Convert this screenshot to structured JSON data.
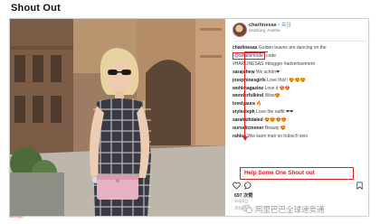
{
  "slide": {
    "title": "Shout Out"
  },
  "post": {
    "username": "charlinesas",
    "follow_label": "• 关注",
    "location": "Salzburg, Austria",
    "comments": [
      {
        "user": "charlinesas",
        "text": "Golden leaves are dancing on the"
      },
      {
        "user": "",
        "text": "code",
        "mention": "@whatismode"
      },
      {
        "user": "",
        "text": "#HARLINESAS #blogger #advertisement"
      },
      {
        "user": "sarajohew",
        "text": "We schön❤"
      },
      {
        "user": "josephinesgirls",
        "text": "Love this!! 😍😍😍"
      },
      {
        "user": "wohlmagazine",
        "text": "Love it 😍😍"
      },
      {
        "user": "wonderfulkind",
        "text": "Wow😍"
      },
      {
        "user": "lovelyaura",
        "text": "🔥"
      },
      {
        "user": "stylesteph",
        "text": "Love the outfit ❤❤"
      },
      {
        "user": "sarahkihdaled",
        "text": "😍😍😍😍"
      },
      {
        "user": "ourselicmoner",
        "text": "Beauty 😍"
      },
      {
        "user": "rahloe",
        "text": "Wie kann man so hübsch sein"
      }
    ],
    "callout": "Help Some One Shout out",
    "likes": "697 次赞",
    "time": "10月2日",
    "add_comment": "添加评论..."
  },
  "watermark": {
    "text": "阿里巴巴全球速卖通"
  },
  "corner_mark": "Sell logo"
}
